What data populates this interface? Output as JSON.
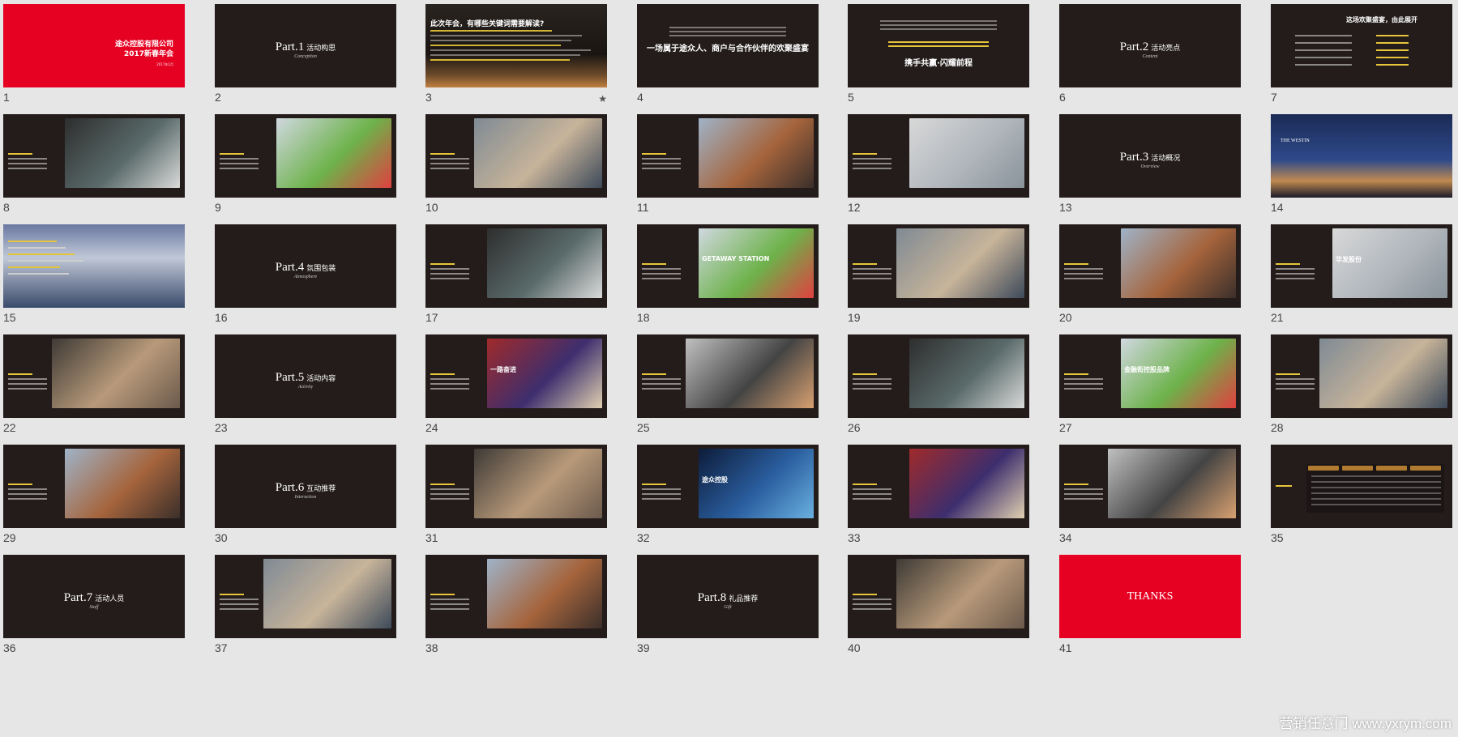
{
  "slides": [
    {
      "n": "1",
      "kind": "cover",
      "bg": "#e60022",
      "title_lines": [
        "途众控股有限公司",
        "2017新春年会"
      ],
      "date": "2017年1月"
    },
    {
      "n": "2",
      "kind": "part",
      "part": "Part.1",
      "title": "活动构思",
      "sub": "Conception"
    },
    {
      "n": "3",
      "kind": "title_text",
      "title": "此次年会，有哪些关键词需要解读?",
      "starred": true
    },
    {
      "n": "4",
      "kind": "center_title",
      "title": "一场属于途众人、商户与合作伙伴的欢聚盛宴"
    },
    {
      "n": "5",
      "kind": "center_title_low",
      "title": "携手共赢·闪耀前程"
    },
    {
      "n": "6",
      "kind": "part",
      "part": "Part.2",
      "title": "活动亮点",
      "sub": "Content"
    },
    {
      "n": "7",
      "kind": "agenda",
      "title": "这场欢聚盛宴，由此展开"
    },
    {
      "n": "8",
      "kind": "photo_right"
    },
    {
      "n": "9",
      "kind": "photo_right"
    },
    {
      "n": "10",
      "kind": "photo_right"
    },
    {
      "n": "11",
      "kind": "photo_right"
    },
    {
      "n": "12",
      "kind": "photo_right"
    },
    {
      "n": "13",
      "kind": "part",
      "part": "Part.3",
      "title": "活动概况",
      "sub": "Overview"
    },
    {
      "n": "14",
      "kind": "photo_full",
      "caption": "THE WESTIN"
    },
    {
      "n": "15",
      "kind": "photo_full_text"
    },
    {
      "n": "16",
      "kind": "part",
      "part": "Part.4",
      "title": "氛围包装",
      "sub": "Atmosphere"
    },
    {
      "n": "17",
      "kind": "photo_right"
    },
    {
      "n": "18",
      "kind": "photo_right",
      "caption": "GETAWAY STATION"
    },
    {
      "n": "19",
      "kind": "photo_right"
    },
    {
      "n": "20",
      "kind": "photo_right"
    },
    {
      "n": "21",
      "kind": "photo_right",
      "caption": "华发股份"
    },
    {
      "n": "22",
      "kind": "photo_right"
    },
    {
      "n": "23",
      "kind": "part",
      "part": "Part.5",
      "title": "活动内容",
      "sub": "Activity"
    },
    {
      "n": "24",
      "kind": "photo_right",
      "caption": "一路奋进"
    },
    {
      "n": "25",
      "kind": "photo_right"
    },
    {
      "n": "26",
      "kind": "photo_right"
    },
    {
      "n": "27",
      "kind": "photo_right",
      "caption": "金融街控股品牌"
    },
    {
      "n": "28",
      "kind": "photo_right"
    },
    {
      "n": "29",
      "kind": "photo_right"
    },
    {
      "n": "30",
      "kind": "part",
      "part": "Part.6",
      "title": "互动推荐",
      "sub": "Interaction"
    },
    {
      "n": "31",
      "kind": "photo_right"
    },
    {
      "n": "32",
      "kind": "photo_right",
      "caption": "途众控股"
    },
    {
      "n": "33",
      "kind": "photo_right"
    },
    {
      "n": "34",
      "kind": "photo_right"
    },
    {
      "n": "35",
      "kind": "table"
    },
    {
      "n": "36",
      "kind": "part",
      "part": "Part.7",
      "title": "活动人员",
      "sub": "Staff"
    },
    {
      "n": "37",
      "kind": "photo_right"
    },
    {
      "n": "38",
      "kind": "photo_right"
    },
    {
      "n": "39",
      "kind": "part",
      "part": "Part.8",
      "title": "礼品推荐",
      "sub": "Gift"
    },
    {
      "n": "40",
      "kind": "photo_right"
    },
    {
      "n": "41",
      "kind": "thanks",
      "bg": "#e60022",
      "title": "THANKS"
    }
  ],
  "watermark": "营销任意门 www.yxrym.com",
  "colors": {
    "slide_bg": "#231c1b",
    "accent_red": "#e60022",
    "page_bg": "#e6e6e6",
    "highlight_yellow": "#e6c53a"
  }
}
